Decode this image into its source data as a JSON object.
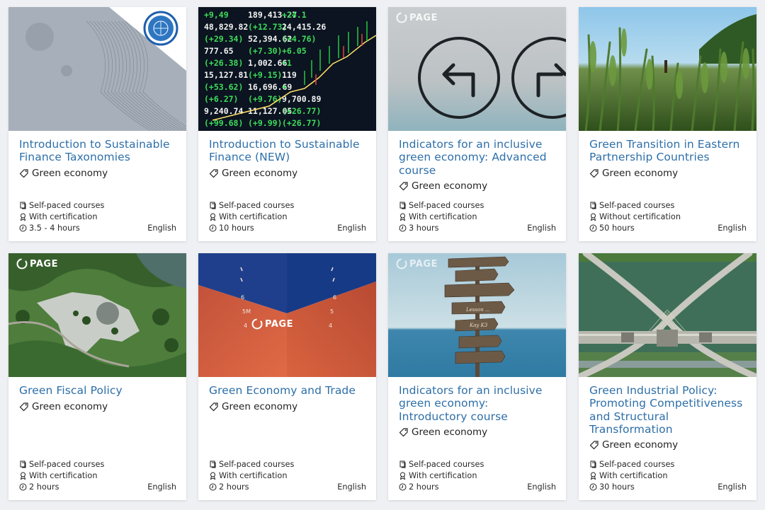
{
  "courses": [
    {
      "title": "Introduction to Sustainable Finance Taxonomies",
      "tag": "Green economy",
      "format": "Self-paced courses",
      "certification": "With certification",
      "duration": "3.5 - 4 hours",
      "language": "English"
    },
    {
      "title": "Introduction to Sustainable Finance (NEW)",
      "tag": "Green economy",
      "format": "Self-paced courses",
      "certification": "With certification",
      "duration": "10 hours",
      "language": "English"
    },
    {
      "title": "Indicators for an inclusive green economy: Advanced course",
      "tag": "Green economy",
      "format": "Self-paced courses",
      "certification": "With certification",
      "duration": "3 hours",
      "language": "English",
      "logo": "PAGE"
    },
    {
      "title": "Green Transition in Eastern Partnership Countries",
      "tag": "Green economy",
      "format": "Self-paced courses",
      "certification": "Without certification",
      "duration": "50 hours",
      "language": "English"
    },
    {
      "title": "Green Fiscal Policy",
      "tag": "Green economy",
      "format": "Self-paced courses",
      "certification": "With certification",
      "duration": "2 hours",
      "language": "English",
      "logo": "PAGE"
    },
    {
      "title": "Green Economy and Trade",
      "tag": "Green economy",
      "format": "Self-paced courses",
      "certification": "With certification",
      "duration": "2 hours",
      "language": "English",
      "logo": "PAGE"
    },
    {
      "title": "Indicators for an inclusive green economy: Introductory course",
      "tag": "Green economy",
      "format": "Self-paced courses",
      "certification": "With certification",
      "duration": "2 hours",
      "language": "English",
      "logo": "PAGE"
    },
    {
      "title": "Green Industrial Policy: Promoting Competitiveness and Structural Transformation",
      "tag": "Green economy",
      "format": "Self-paced courses",
      "certification": "With certification",
      "duration": "30 hours",
      "language": "English"
    }
  ],
  "stock_ticker": {
    "rows": [
      [
        "+9,49",
        "189,413.27",
        "+24.1"
      ],
      [
        "48,829.82",
        "(+12.73)",
        "24,415.26"
      ],
      [
        "(+29.34)",
        "52,394.62",
        "(+4.76)"
      ],
      [
        "777.65",
        "(+7.30)",
        "+6.05"
      ],
      [
        "(+26.38)",
        "1,002.66",
        "+1"
      ],
      [
        "15,127.81",
        "(+9.15)",
        "119"
      ],
      [
        "(+53.62)",
        "16,696.69",
        "+"
      ],
      [
        "(+6.27)",
        "(+9.76)",
        "9,700.89"
      ],
      [
        "9,240.74",
        "11,127.05",
        "(+26.77)"
      ],
      [
        "(+99.68)",
        "(+9.99)",
        "(+26.77)"
      ]
    ]
  },
  "signposts": [
    "",
    "",
    "",
    "",
    "Lesson ...",
    "Kay K3",
    ""
  ],
  "colors": {
    "link": "#2d6fa9",
    "background": "#eef0f3",
    "card": "#ffffff"
  }
}
